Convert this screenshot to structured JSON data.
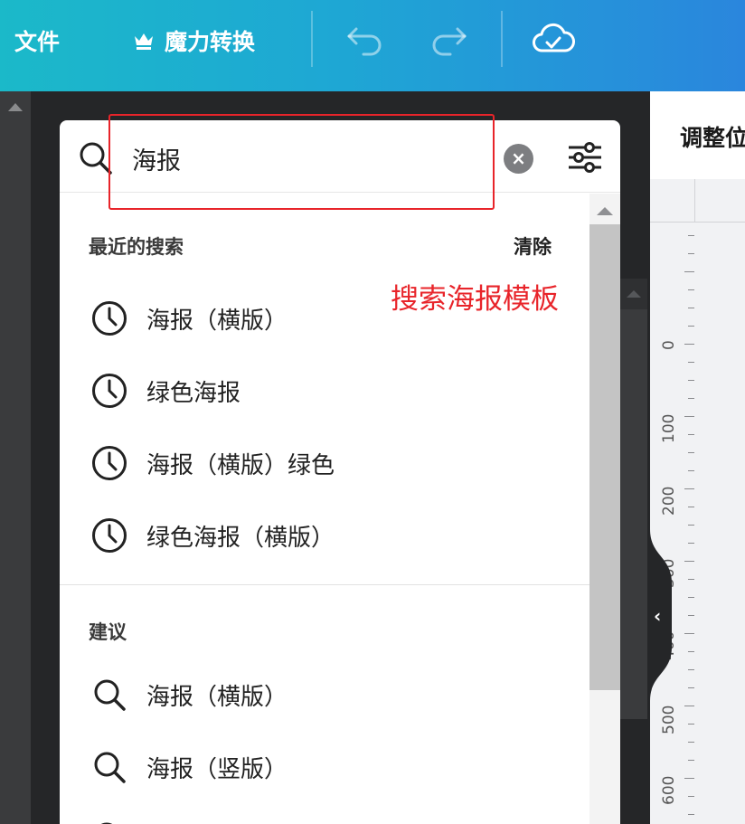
{
  "toolbar": {
    "file_label": "文件",
    "magic_label": "魔力转换",
    "crown_icon": "crown-icon",
    "undo_icon": "undo-icon",
    "redo_icon": "redo-icon",
    "cloud_icon": "cloud-check-icon"
  },
  "right_panel": {
    "title": "调整位",
    "ruler_labels": [
      "0",
      "100",
      "200",
      "300",
      "400",
      "500",
      "600"
    ]
  },
  "search": {
    "value": "海报",
    "clear_icon": "clear-icon",
    "filter_icon": "filter-sliders-icon"
  },
  "recent": {
    "title": "最近的搜索",
    "clear_label": "清除",
    "items": [
      {
        "label": "海报（横版）",
        "icon": "clock-icon"
      },
      {
        "label": "绿色海报",
        "icon": "clock-icon"
      },
      {
        "label": "海报（横版）绿色",
        "icon": "clock-icon"
      },
      {
        "label": "绿色海报（横版）",
        "icon": "clock-icon"
      }
    ]
  },
  "suggest": {
    "title": "建议",
    "items": [
      {
        "label": "海报（横版）",
        "icon": "search-icon"
      },
      {
        "label": "海报（竖版）",
        "icon": "search-icon"
      }
    ]
  },
  "annotation": {
    "label": "搜索海报模板",
    "color": "#e8242a"
  },
  "colors": {
    "topbar_start": "#1bb9c9",
    "topbar_end": "#2a86dd"
  }
}
